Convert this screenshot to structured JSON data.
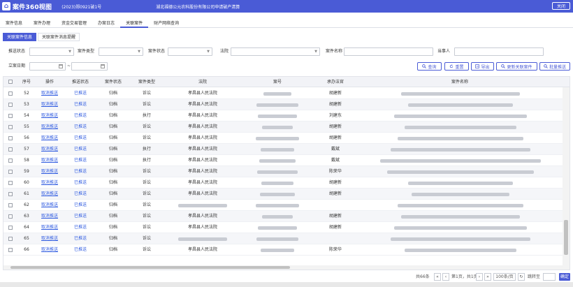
{
  "app": {
    "title": "案件360视图",
    "case_no": "(2023)郑0921破1号",
    "party": "湖北福德公元农科股份有限公司申请破产清算",
    "close_label": "关闭"
  },
  "main_tabs": [
    "案件信息",
    "案件办理",
    "资金交易管理",
    "办案日志",
    "关联案件",
    "财产网络查询"
  ],
  "active_main_tab": "关联案件",
  "sub_tabs": [
    "关联案件信息",
    "关联案件消息提醒"
  ],
  "active_sub_tab": "关联案件信息",
  "filters": {
    "push_status_label": "推送状态",
    "case_type_label": "案件类型",
    "case_status_label": "案件状态",
    "court_label": "法院",
    "case_name_label": "案件名称",
    "party_label": "当事人",
    "filing_date_label": "立案日期",
    "date_sep": "~"
  },
  "buttons": {
    "search": "查询",
    "reset": "重置",
    "export": "导出",
    "update": "更新关联案件",
    "batch_push": "批量推送"
  },
  "table": {
    "headers": [
      "序号",
      "操作",
      "推送状态",
      "案件状态",
      "案件类型",
      "法院",
      "案号",
      "承办法官",
      "案件名称"
    ],
    "rows": [
      {
        "no": "52",
        "action": "取消推送",
        "push": "已推送",
        "status": "归档",
        "type": "诉讼",
        "court": "孝昌县人民法院",
        "judge": "胡建新"
      },
      {
        "no": "53",
        "action": "取消推送",
        "push": "已推送",
        "status": "归档",
        "type": "诉讼",
        "court": "孝昌县人民法院",
        "judge": "胡建新"
      },
      {
        "no": "54",
        "action": "取消推送",
        "push": "已推送",
        "status": "归档",
        "type": "执行",
        "court": "孝昌县人民法院",
        "judge": "刘建东"
      },
      {
        "no": "55",
        "action": "取消推送",
        "push": "已推送",
        "status": "归档",
        "type": "诉讼",
        "court": "孝昌县人民法院",
        "judge": "胡建新"
      },
      {
        "no": "56",
        "action": "取消推送",
        "push": "已推送",
        "status": "归档",
        "type": "诉讼",
        "court": "孝昌县人民法院",
        "judge": "胡建新"
      },
      {
        "no": "57",
        "action": "取消推送",
        "push": "已推送",
        "status": "归档",
        "type": "执行",
        "court": "孝昌县人民法院",
        "judge": "戴斌"
      },
      {
        "no": "58",
        "action": "取消推送",
        "push": "已推送",
        "status": "归档",
        "type": "执行",
        "court": "孝昌县人民法院",
        "judge": "戴斌"
      },
      {
        "no": "59",
        "action": "取消推送",
        "push": "已推送",
        "status": "归档",
        "type": "诉讼",
        "court": "孝昌县人民法院",
        "judge": "陈荣华"
      },
      {
        "no": "60",
        "action": "取消推送",
        "push": "已推送",
        "status": "归档",
        "type": "诉讼",
        "court": "孝昌县人民法院",
        "judge": "胡建新"
      },
      {
        "no": "61",
        "action": "取消推送",
        "push": "已推送",
        "status": "归档",
        "type": "诉讼",
        "court": "孝昌县人民法院",
        "judge": "胡建新"
      },
      {
        "no": "62",
        "action": "取消推送",
        "push": "已推送",
        "status": "归档",
        "type": "诉讼",
        "court": "",
        "judge": ""
      },
      {
        "no": "63",
        "action": "取消推送",
        "push": "已推送",
        "status": "归档",
        "type": "诉讼",
        "court": "孝昌县人民法院",
        "judge": "胡建新"
      },
      {
        "no": "64",
        "action": "取消推送",
        "push": "已推送",
        "status": "归档",
        "type": "诉讼",
        "court": "孝昌县人民法院",
        "judge": "胡建新"
      },
      {
        "no": "65",
        "action": "取消推送",
        "push": "已推送",
        "status": "归档",
        "type": "诉讼",
        "court": "",
        "judge": ""
      },
      {
        "no": "66",
        "action": "取消推送",
        "push": "已推送",
        "status": "归档",
        "type": "诉讼",
        "court": "孝昌县人民法院",
        "judge": "陈荣华"
      }
    ]
  },
  "pager": {
    "total": "共66条",
    "page_info": "第1页，共1页",
    "page_size": "100条/页",
    "goto_label": "跳转至",
    "confirm": "确定"
  },
  "colors": {
    "accent": "#4a5bd6",
    "link": "#2f5be0"
  }
}
